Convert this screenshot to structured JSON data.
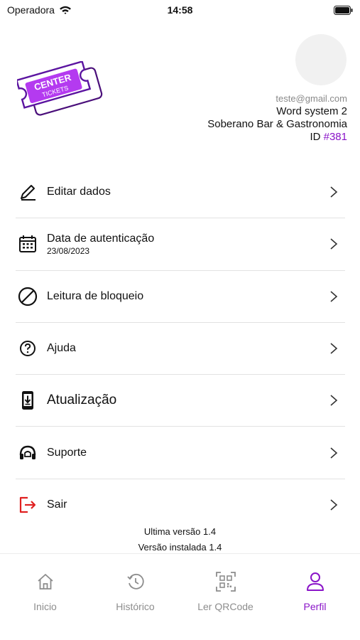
{
  "status_bar": {
    "carrier": "Operadora",
    "time": "14:58"
  },
  "profile": {
    "email": "teste@gmail.com",
    "company": "Word system 2",
    "venue": "Soberano Bar & Gastronomia",
    "id_prefix": "ID ",
    "id_value": "#381"
  },
  "logo": {
    "text_line1": "CENTER",
    "text_line2": "TICKETS"
  },
  "menu": [
    {
      "label": "Editar dados",
      "icon": "pencil-icon"
    },
    {
      "label": "Data de autenticação",
      "sub": "23/08/2023",
      "icon": "calendar-icon"
    },
    {
      "label": "Leitura de bloqueio",
      "icon": "block-icon"
    },
    {
      "label": "Ajuda",
      "icon": "help-icon"
    },
    {
      "label": "Atualização",
      "icon": "phone-download-icon"
    },
    {
      "label": "Suporte",
      "icon": "headset-icon"
    },
    {
      "label": "Sair",
      "icon": "logout-icon"
    }
  ],
  "versions": {
    "latest": "Ultima versão 1.4",
    "installed": "Versão instalada 1.4"
  },
  "tabs": [
    {
      "label": "Inicio",
      "icon": "home-icon"
    },
    {
      "label": "Histórico",
      "icon": "history-icon"
    },
    {
      "label": "Ler QRCode",
      "icon": "qrcode-icon"
    },
    {
      "label": "Perfil",
      "icon": "user-icon",
      "active": true
    }
  ],
  "colors": {
    "accent": "#8a14c8",
    "logout": "#e02020",
    "inactive": "#8d8d8d"
  }
}
